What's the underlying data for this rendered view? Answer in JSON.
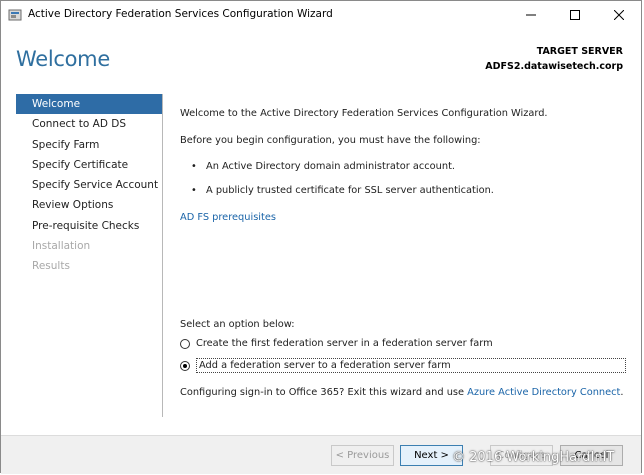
{
  "window": {
    "title": "Active Directory Federation Services Configuration Wizard",
    "controls": {
      "minimize": "—",
      "maximize": "☐",
      "close": "✕"
    }
  },
  "header": {
    "page_title": "Welcome",
    "target_label": "TARGET SERVER",
    "target_server": "ADFS2.datawisetech.corp"
  },
  "sidebar": {
    "items": [
      {
        "label": "Welcome",
        "state": "active"
      },
      {
        "label": "Connect to AD DS",
        "state": "normal"
      },
      {
        "label": "Specify Farm",
        "state": "normal"
      },
      {
        "label": "Specify Certificate",
        "state": "normal"
      },
      {
        "label": "Specify Service Account",
        "state": "normal"
      },
      {
        "label": "Review Options",
        "state": "normal"
      },
      {
        "label": "Pre-requisite Checks",
        "state": "normal"
      },
      {
        "label": "Installation",
        "state": "disabled"
      },
      {
        "label": "Results",
        "state": "disabled"
      }
    ]
  },
  "content": {
    "intro": "Welcome to the Active Directory Federation Services Configuration Wizard.",
    "before": "Before you begin configuration, you must have the following:",
    "bullets": [
      "An Active Directory domain administrator account.",
      "A publicly trusted certificate for SSL server authentication."
    ],
    "prereq_link": "AD FS prerequisites",
    "select_prompt": "Select an option below:",
    "options": [
      {
        "label": "Create the first federation server in a federation server farm",
        "checked": false
      },
      {
        "label": "Add a federation server to a federation server farm",
        "checked": true
      }
    ],
    "office_text": "Configuring sign-in to Office 365? Exit this wizard and use ",
    "office_link": "Azure Active Directory Connect",
    "office_end": "."
  },
  "footer": {
    "previous": "< Previous",
    "next": "Next >",
    "configure": "Configure",
    "cancel": "Cancel"
  },
  "watermark": "© 2016 WorkingHardInIT",
  "colors": {
    "accent": "#2e6ca6",
    "title_blue": "#2f6f9f",
    "link": "#1a64a8",
    "disabled_text": "#a8a8a8"
  }
}
